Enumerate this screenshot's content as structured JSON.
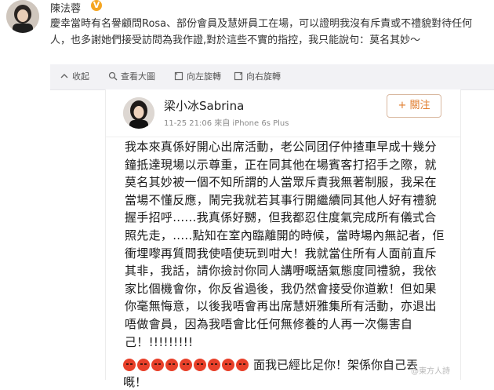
{
  "post": {
    "author": "陳法蓉",
    "badge": "V",
    "text": "慶幸當時有名譽顧問Rosa、部份會員及慧妍員工在場，可以證明我沒有斥責或不禮貌對待任何人，也多謝她們接受訪問為我作證,對於這些不實的指控，我只能說句：莫名其妙～"
  },
  "toolbar": {
    "collapse": "收起",
    "view_large": "查看大圖",
    "rotate_left": "向左旋轉",
    "rotate_right": "向右旋轉"
  },
  "inner_post": {
    "name": "梁小冰Sabrina",
    "meta": "11-25 21:06  來自 iPhone 6s Plus",
    "follow": "+ 關注",
    "body": "我本來真係好開心出席活動，老公同团仔仲揸車早成十幾分鐘抵達現場以示尊重，正在同其他在場賓客打招手之際，就莫名其妙被一個不知所謂的人當眾斥責我無著制服，我呆在當場不懂反應，鬧完我就若其事行開繼續同其他人好有禮貌握手招呼......我真係好嬲，但我都忍住度氣完成所有儀式合照先走，.....點知在室內臨離開的時候，當時場內無記者，佢衝埋嚟再質問我使唔使玩到咁大！我就當住所有人面前直斥其非，我話，請你撿討你同人講嘢嘅語氣態度同禮貌，我依家比個機會你，你反省過後，我仍然會接受你道歉！但如果你毫無悔意，以後我唔會再出席慧妍雅集所有活動，亦退出唔做會員，因為我唔會比任何無修養的人再一次傷害自己！!!!!!!!!!",
    "emoji_count": 9,
    "emoji_text": "面我已經比足你！架係你自己丟",
    "last_line": "嘅！",
    "angry_color": "#e8402a"
  },
  "watermark": "@東方人詩"
}
